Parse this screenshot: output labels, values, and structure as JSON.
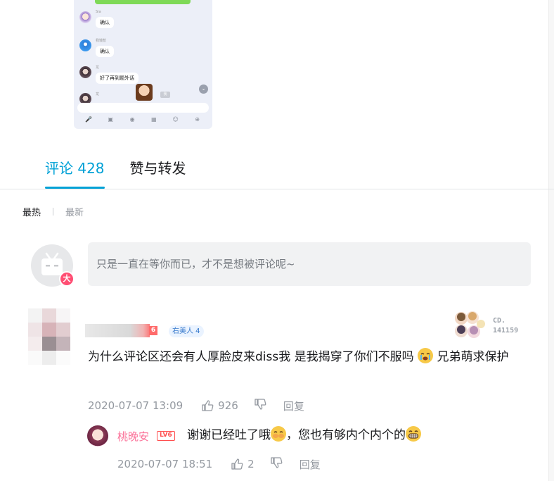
{
  "phone_preview": {
    "messages": [
      {
        "name": "Sia",
        "text": "确认"
      },
      {
        "name": "我饿惹",
        "text": "确认"
      },
      {
        "name": "龙",
        "text": "好了再到题外话"
      },
      {
        "name": "龙",
        "text": ""
      }
    ],
    "mini_label": "我"
  },
  "tabs": [
    {
      "label": "评论 428",
      "active": true
    },
    {
      "label": "赞与转发",
      "active": false
    }
  ],
  "sort": {
    "hot": "最热",
    "new": "最新"
  },
  "reply_box": {
    "placeholder": "只是一直在等你而已，才不是想被评论呢~",
    "badge": "大"
  },
  "comment": {
    "level": "6",
    "tag": "右美人 4",
    "fan_card": {
      "line1": "CD.",
      "line2": "141159"
    },
    "text_part1": "为什么评论区还会有人厚脸皮来diss我 是我揭穿了你们不服吗",
    "text_part2": " 兄弟萌求保护",
    "time": "2020-07-07 13:09",
    "likes": "926",
    "reply_label": "回复"
  },
  "sub_reply": {
    "name": "桃晚安",
    "level": "LV6",
    "text_part1": "谢谢已经吐了哦",
    "text_part2": "，您也有够内个内个的",
    "time": "2020-07-07 18:51",
    "likes": "2",
    "reply_label": "回复"
  },
  "colors": {
    "accent": "#00a1d6",
    "pink": "#fb7299",
    "muted": "#9499a0"
  }
}
